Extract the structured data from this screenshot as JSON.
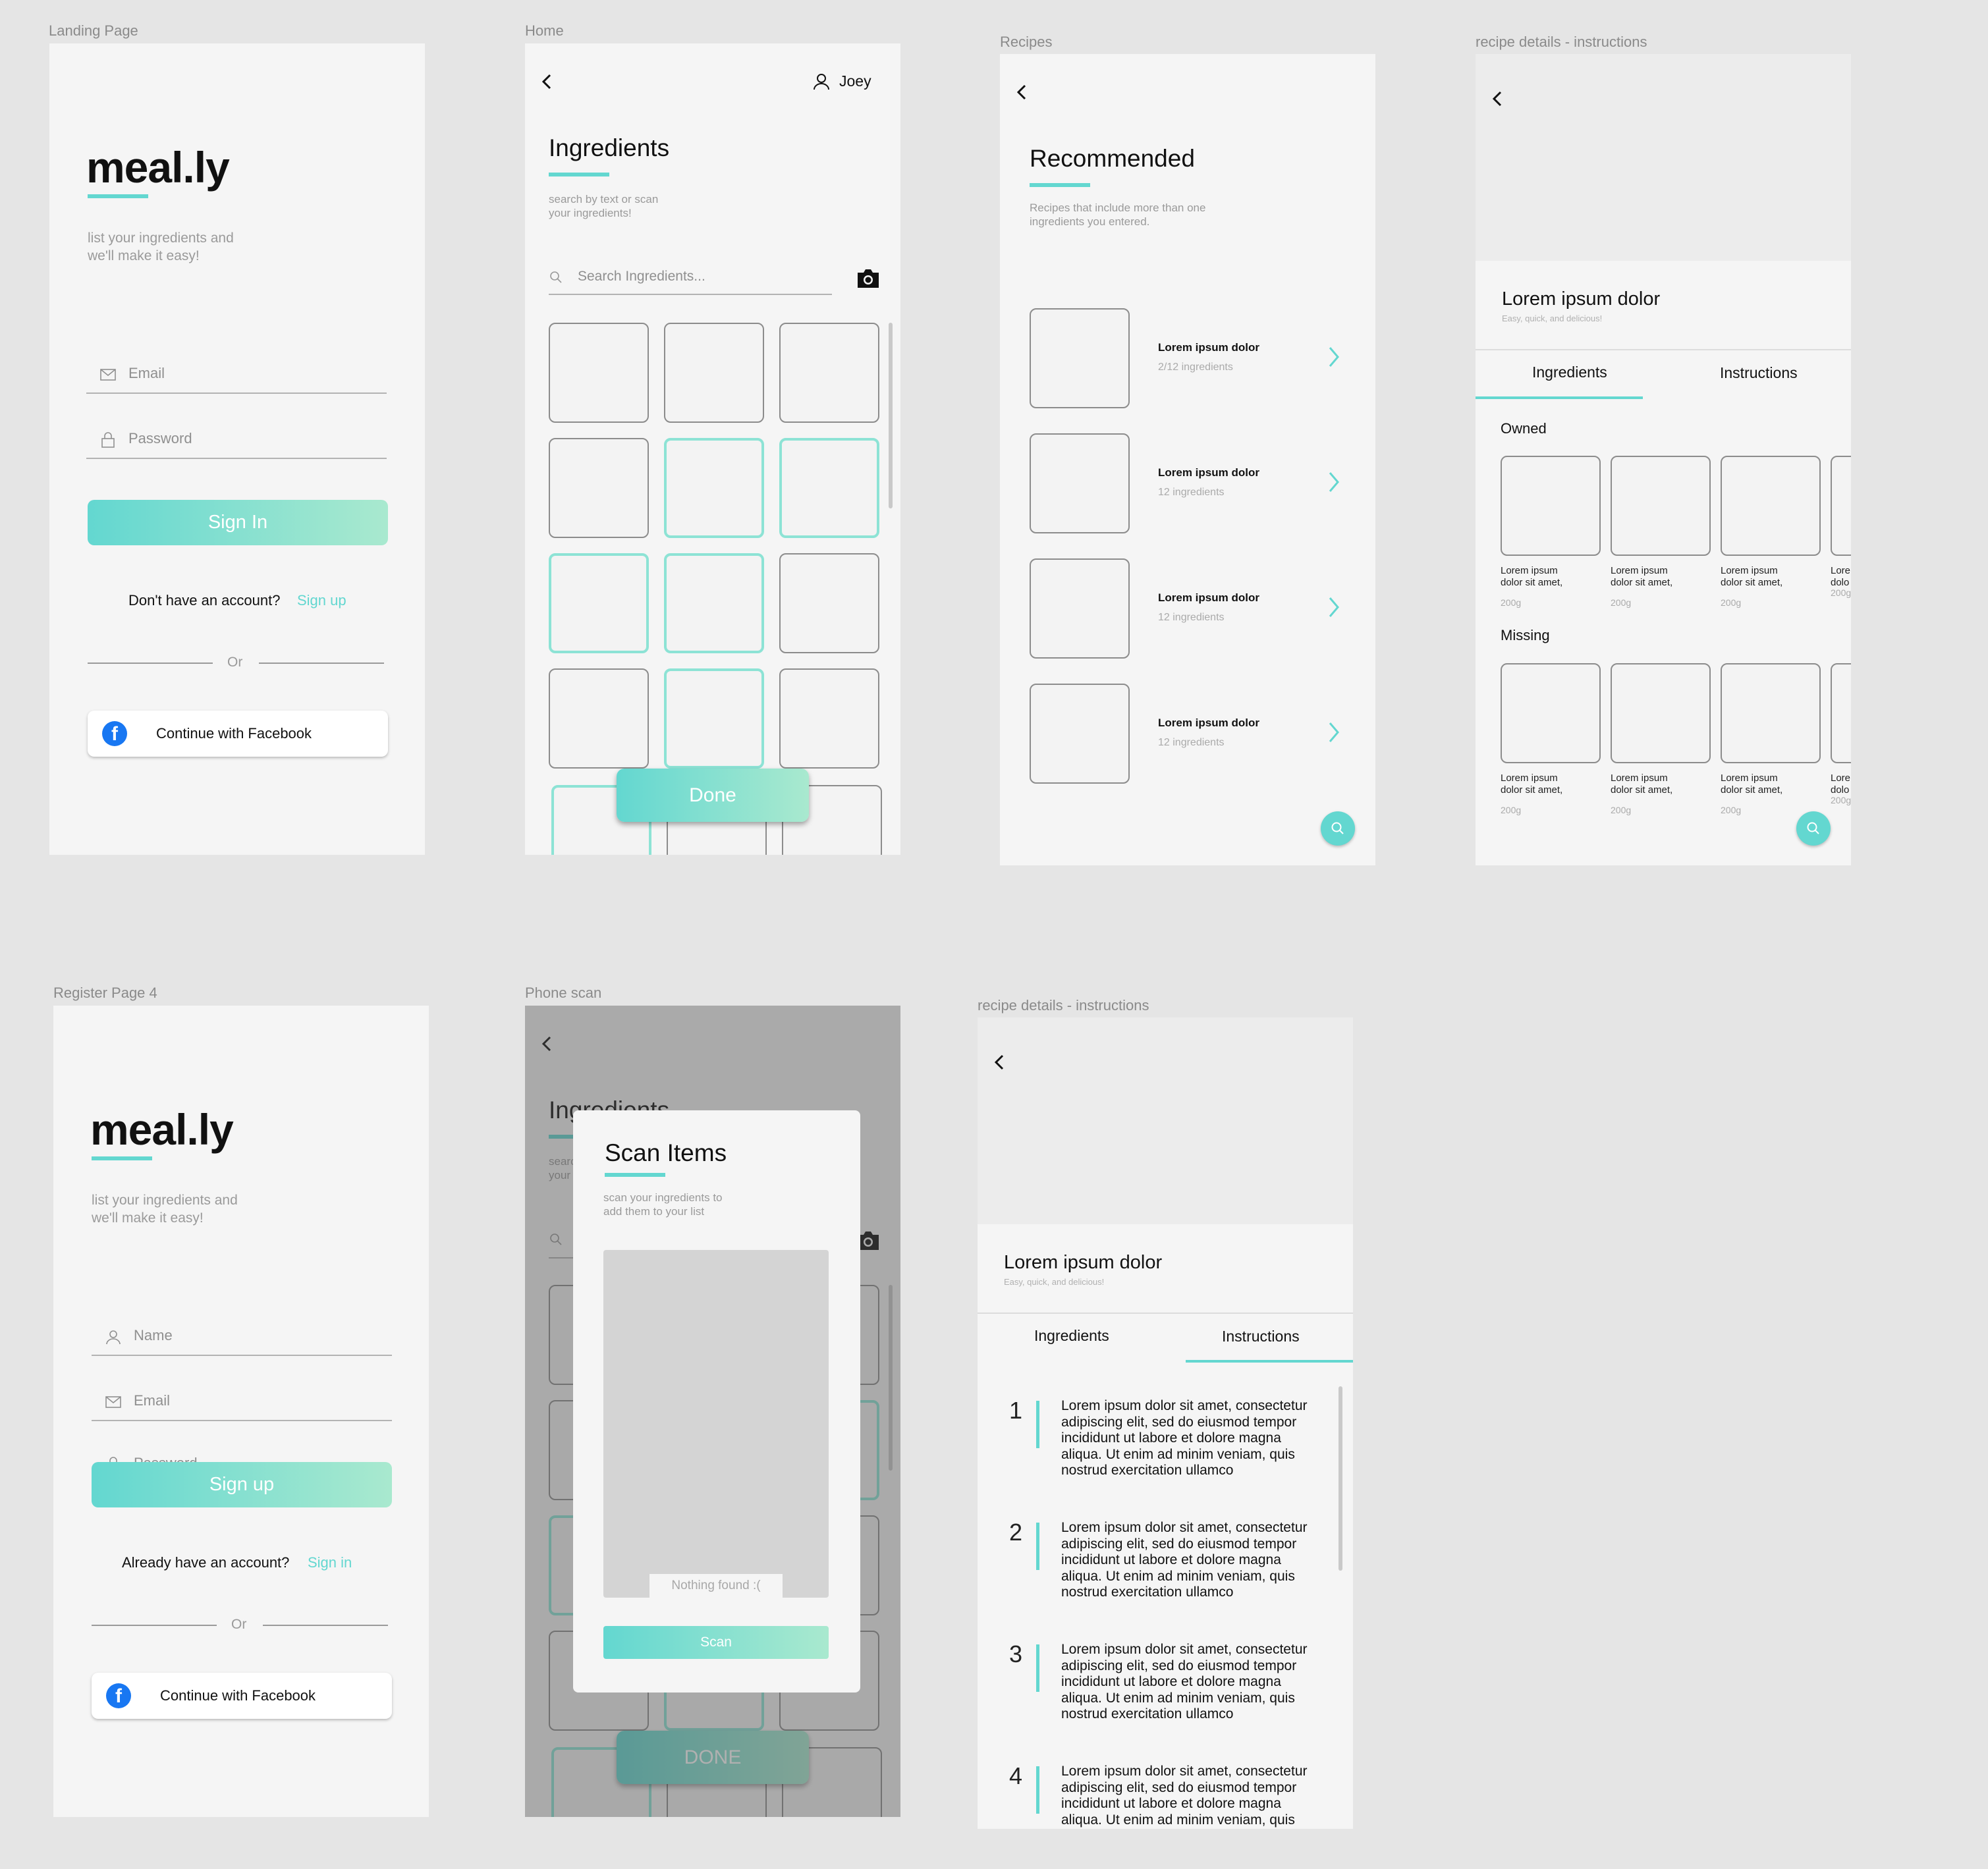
{
  "frame_labels": {
    "landing": "Landing Page",
    "home": "Home",
    "recipes": "Recipes",
    "details1": "recipe details - instructions",
    "register": "Register Page 4",
    "scan": "Phone scan",
    "details2": "recipe details - instructions"
  },
  "landing": {
    "logo": "meal.ly",
    "tagline_1": "list your ingredients and",
    "tagline_2": "we'll make it easy!",
    "email_placeholder": "Email",
    "password_placeholder": "Password",
    "sign_in": "Sign In",
    "no_account": "Don't have an account?",
    "sign_up_link": "Sign up",
    "or": "Or",
    "facebook": "Continue with Facebook"
  },
  "home": {
    "user": "Joey",
    "title": "Ingredients",
    "sub_1": "search by text or scan",
    "sub_2": "your ingredients!",
    "search_placeholder": "Search Ingredients...",
    "done": "Done",
    "grid_selected": [
      [
        false,
        false,
        false
      ],
      [
        false,
        true,
        true
      ],
      [
        true,
        true,
        false
      ],
      [
        false,
        true,
        false
      ]
    ]
  },
  "recipes": {
    "title": "Recommended",
    "sub_1": "Recipes that include more than one",
    "sub_2": "ingredients you entered.",
    "items": [
      {
        "name": "Lorem ipsum dolor",
        "count": "2/12 ingredients"
      },
      {
        "name": "Lorem ipsum dolor",
        "count": "12 ingredients"
      },
      {
        "name": "Lorem ipsum dolor",
        "count": "12 ingredients"
      },
      {
        "name": "Lorem ipsum dolor",
        "count": "12 ingredients"
      }
    ]
  },
  "details": {
    "title": "Lorem ipsum dolor",
    "subtitle": "Easy, quick, and delicious!",
    "tab_ingredients": "Ingredients",
    "tab_instructions": "Instructions",
    "owned": "Owned",
    "missing": "Missing",
    "item_line1": "Lorem ipsum",
    "item_line2": "dolor sit amet,",
    "item_weight": "200g",
    "item_partial_1": "Lore",
    "item_partial_2": "dolo",
    "item_partial_w": "200g"
  },
  "register": {
    "logo": "meal.ly",
    "tagline_1": "list your ingredients and",
    "tagline_2": "we'll make it easy!",
    "name_placeholder": "Name",
    "email_placeholder": "Email",
    "password_placeholder": "Password",
    "sign_up": "Sign up",
    "have_account": "Already have an account?",
    "sign_in_link": "Sign in",
    "or": "Or",
    "facebook": "Continue with Facebook"
  },
  "scan": {
    "bg_title": "Ingredients",
    "bg_sub_1": "search by text or scan",
    "bg_sub_2": "your ingredients!",
    "modal_title": "Scan Items",
    "modal_sub_1": "scan your ingredients to",
    "modal_sub_2": "add them to your list",
    "nothing_found": "Nothing found :(",
    "scan_button": "Scan",
    "done": "DONE"
  },
  "instructions": {
    "steps": [
      {
        "n": "1",
        "text": "Lorem ipsum dolor sit amet, consectetur adipiscing elit, sed do eiusmod tempor incididunt ut labore et dolore magna aliqua. Ut enim ad minim veniam, quis nostrud exercitation ullamco"
      },
      {
        "n": "2",
        "text": "Lorem ipsum dolor sit amet, consectetur adipiscing elit, sed do eiusmod tempor incididunt ut labore et dolore magna aliqua. Ut enim ad minim veniam, quis nostrud exercitation ullamco"
      },
      {
        "n": "3",
        "text": "Lorem ipsum dolor sit amet, consectetur adipiscing elit, sed do eiusmod tempor incididunt ut labore et dolore magna aliqua. Ut enim ad minim veniam, quis nostrud exercitation ullamco"
      },
      {
        "n": "4",
        "text": "Lorem ipsum dolor sit amet, consectetur adipiscing elit, sed do eiusmod tempor incididunt ut labore et dolore magna aliqua. Ut enim ad minim veniam, quis"
      }
    ]
  },
  "colors": {
    "accent": "#63d7d0",
    "accent_light": "#a9e9cf",
    "background": "#e5e5e5",
    "frame": "#f5f5f5"
  }
}
